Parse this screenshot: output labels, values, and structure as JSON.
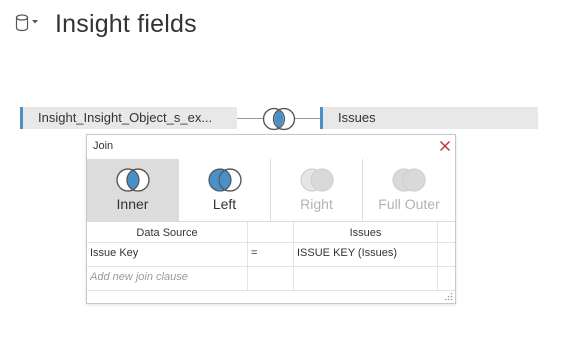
{
  "header": {
    "title": "Insight fields",
    "datasource_icon": "database-icon",
    "dropdown_icon": "caret-down-icon"
  },
  "join_bar": {
    "left_table": "Insight_Insight_Object_s_ex...",
    "right_table": "Issues",
    "join_icon": "left-join-icon"
  },
  "join_dialog": {
    "title": "Join",
    "close_icon": "close-icon",
    "join_types": [
      {
        "label": "Inner",
        "icon": "inner-join-icon",
        "selected": true,
        "enabled": true
      },
      {
        "label": "Left",
        "icon": "left-join-icon",
        "selected": false,
        "enabled": true
      },
      {
        "label": "Right",
        "icon": "right-join-icon",
        "selected": false,
        "enabled": false
      },
      {
        "label": "Full Outer",
        "icon": "full-outer-join-icon",
        "selected": false,
        "enabled": false
      }
    ],
    "clause_table": {
      "headers": [
        "Data Source",
        "",
        "Issues"
      ],
      "rows": [
        {
          "left": "Issue Key",
          "operator": "=",
          "right": "ISSUE KEY (Issues)"
        }
      ],
      "add_placeholder": "Add new join clause"
    }
  },
  "colors": {
    "accent_blue": "#4a90c8",
    "close_red": "#c0392b",
    "selected_bg": "#dcdcdc"
  }
}
